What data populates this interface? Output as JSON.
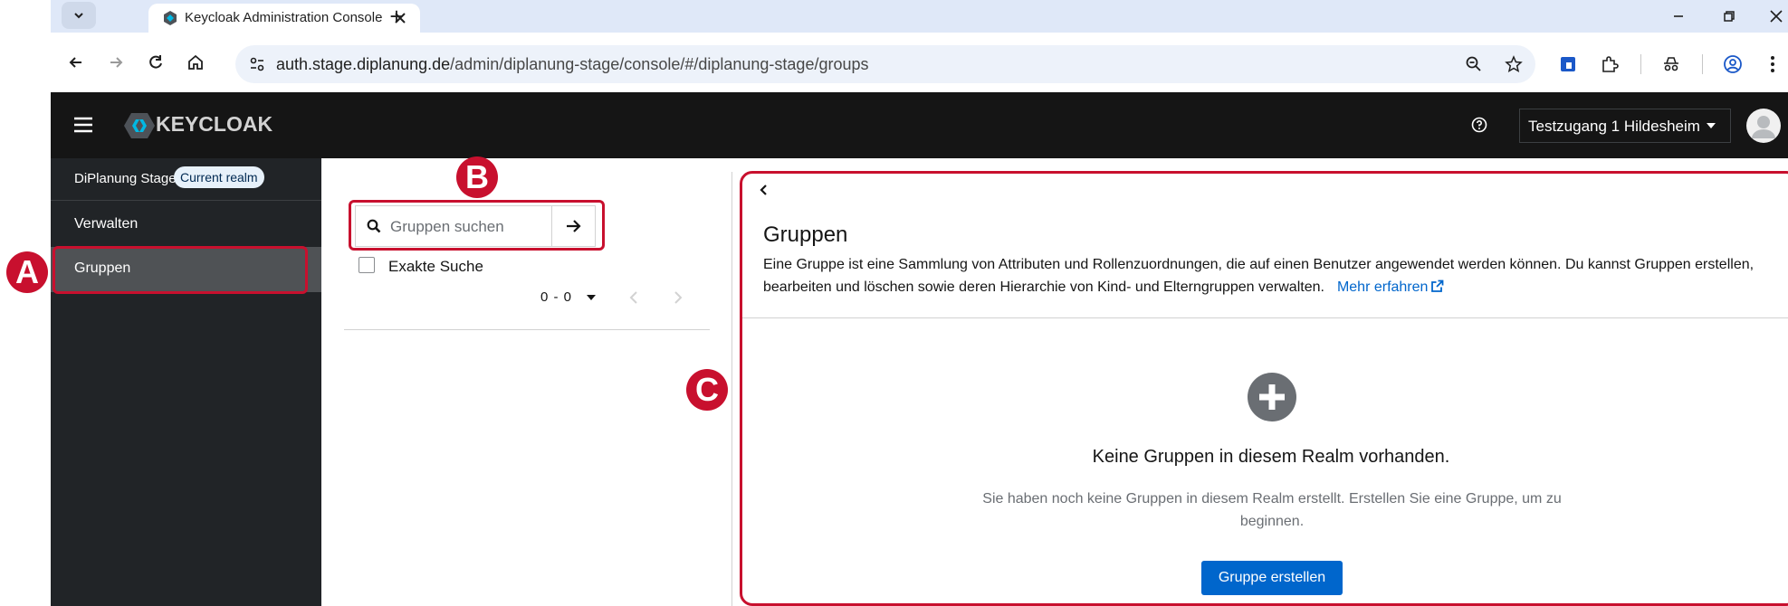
{
  "browser": {
    "tab_title": "Keycloak Administration Console",
    "url_host": "auth.stage.diplanung.de",
    "url_path": "/admin/diplanung-stage/console/#/diplanung-stage/groups",
    "new_tab_symbol": "+",
    "icons": [
      "tab-list-icon",
      "keycloak-favicon-icon",
      "close-tab-icon",
      "new-tab-icon",
      "minimize-icon",
      "restore-icon",
      "close-window-icon",
      "back-icon",
      "forward-icon",
      "reload-icon",
      "home-icon",
      "site-settings-icon",
      "zoom-icon",
      "bookmark-star-icon",
      "extension-icon",
      "puzzle-icon",
      "incognito-icon",
      "profile-icon",
      "more-menu-icon"
    ]
  },
  "header": {
    "logo_text": "KEYCLOAK",
    "user_name": "Testzugang 1 Hildesheim",
    "icons": [
      "hamburger-icon",
      "help-icon",
      "caret-down-icon",
      "avatar-icon"
    ]
  },
  "sidebar": {
    "realm_name": "DiPlanung Stage",
    "realm_badge": "Current realm",
    "items": [
      {
        "label": "Verwalten"
      },
      {
        "label": "Gruppen",
        "selected": true
      }
    ]
  },
  "groups_tree": {
    "search_placeholder": "Gruppen suchen",
    "exact_search_label": "Exakte Suche",
    "pagination": "0 - 0"
  },
  "main": {
    "title": "Gruppen",
    "description": "Eine Gruppe ist eine Sammlung von Attributen und Rollenzuordnungen, die auf einen Benutzer angewendet werden können. Du kannst Gruppen erstellen, bearbeiten und löschen sowie deren Hierarchie von Kind- und Elterngruppen verwalten.",
    "learn_more": "Mehr erfahren",
    "empty_title": "Keine Gruppen in diesem Realm vorhanden.",
    "empty_body": "Sie haben noch keine Gruppen in diesem Realm erstellt. Erstellen Sie eine Gruppe, um zu beginnen.",
    "create_button": "Gruppe erstellen"
  },
  "annotations": [
    "A",
    "B",
    "C"
  ],
  "colors": {
    "annotation_red": "#c8102e",
    "primary_blue": "#0066cc",
    "masthead": "#151515",
    "sidebar": "#212427"
  }
}
